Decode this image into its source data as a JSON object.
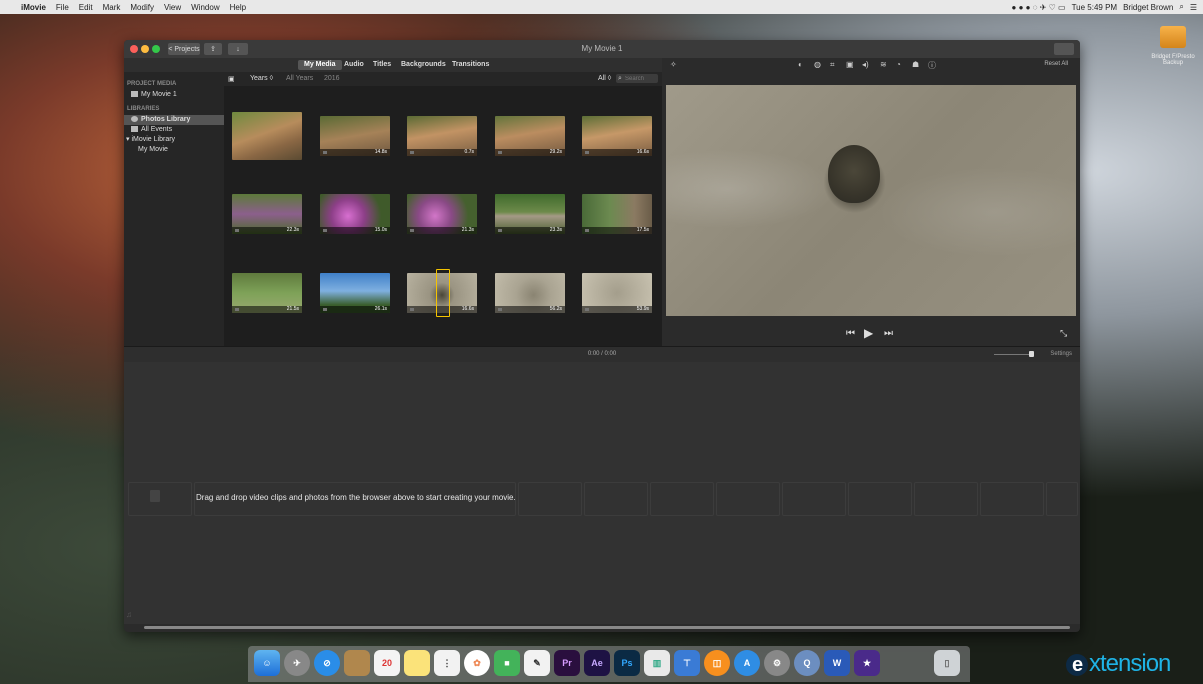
{
  "menubar": {
    "app": "iMovie",
    "menus": [
      "File",
      "Edit",
      "Mark",
      "Modify",
      "View",
      "Window",
      "Help"
    ],
    "clock": "Tue 5:49 PM",
    "user": "Bridget Brown"
  },
  "desktop": {
    "drive_label": "Bridget F/Presto Backup"
  },
  "window": {
    "title": "My Movie 1",
    "projects_button": "< Projects"
  },
  "tabs": [
    "My Media",
    "Audio",
    "Titles",
    "Backgrounds",
    "Transitions"
  ],
  "sidebar": {
    "project_media_heading": "PROJECT MEDIA",
    "project_item": "My Movie 1",
    "libraries_heading": "LIBRARIES",
    "items": [
      "Photos Library",
      "All Events",
      "iMovie Library",
      "My Movie"
    ]
  },
  "browser": {
    "years_label": "Years ◊",
    "all_years": "All Years",
    "year": "2016",
    "filter": "All ◊",
    "search_placeholder": "Search",
    "clips": [
      {
        "duration": ""
      },
      {
        "duration": "14.8s"
      },
      {
        "duration": "0.7s"
      },
      {
        "duration": "29.2s"
      },
      {
        "duration": "16.6s"
      },
      {
        "duration": "22.3s"
      },
      {
        "duration": "15.0s"
      },
      {
        "duration": "21.3s"
      },
      {
        "duration": "23.3s"
      },
      {
        "duration": "17.5s"
      },
      {
        "duration": "21.5s"
      },
      {
        "duration": "26.1s"
      },
      {
        "duration": "16.6s"
      },
      {
        "duration": "56.2s"
      },
      {
        "duration": "53.9s"
      }
    ]
  },
  "viewer": {
    "reset_all": "Reset All",
    "tool_icons": [
      "color-balance-icon",
      "color-correction-icon",
      "crop-icon",
      "stabilization-icon",
      "volume-icon",
      "noise-reduction-icon",
      "speed-icon",
      "filter-icon",
      "info-icon"
    ]
  },
  "timeline": {
    "timecode": "0:00 / 0:00",
    "settings": "Settings",
    "hint": "Drag and drop video clips and photos from the browser above to start creating your movie."
  },
  "watermark": {
    "e": "e",
    "rest": "xtension"
  },
  "colors": {
    "accent_yellow": "#f5c400",
    "extension_blue": "#1fb3e5"
  }
}
